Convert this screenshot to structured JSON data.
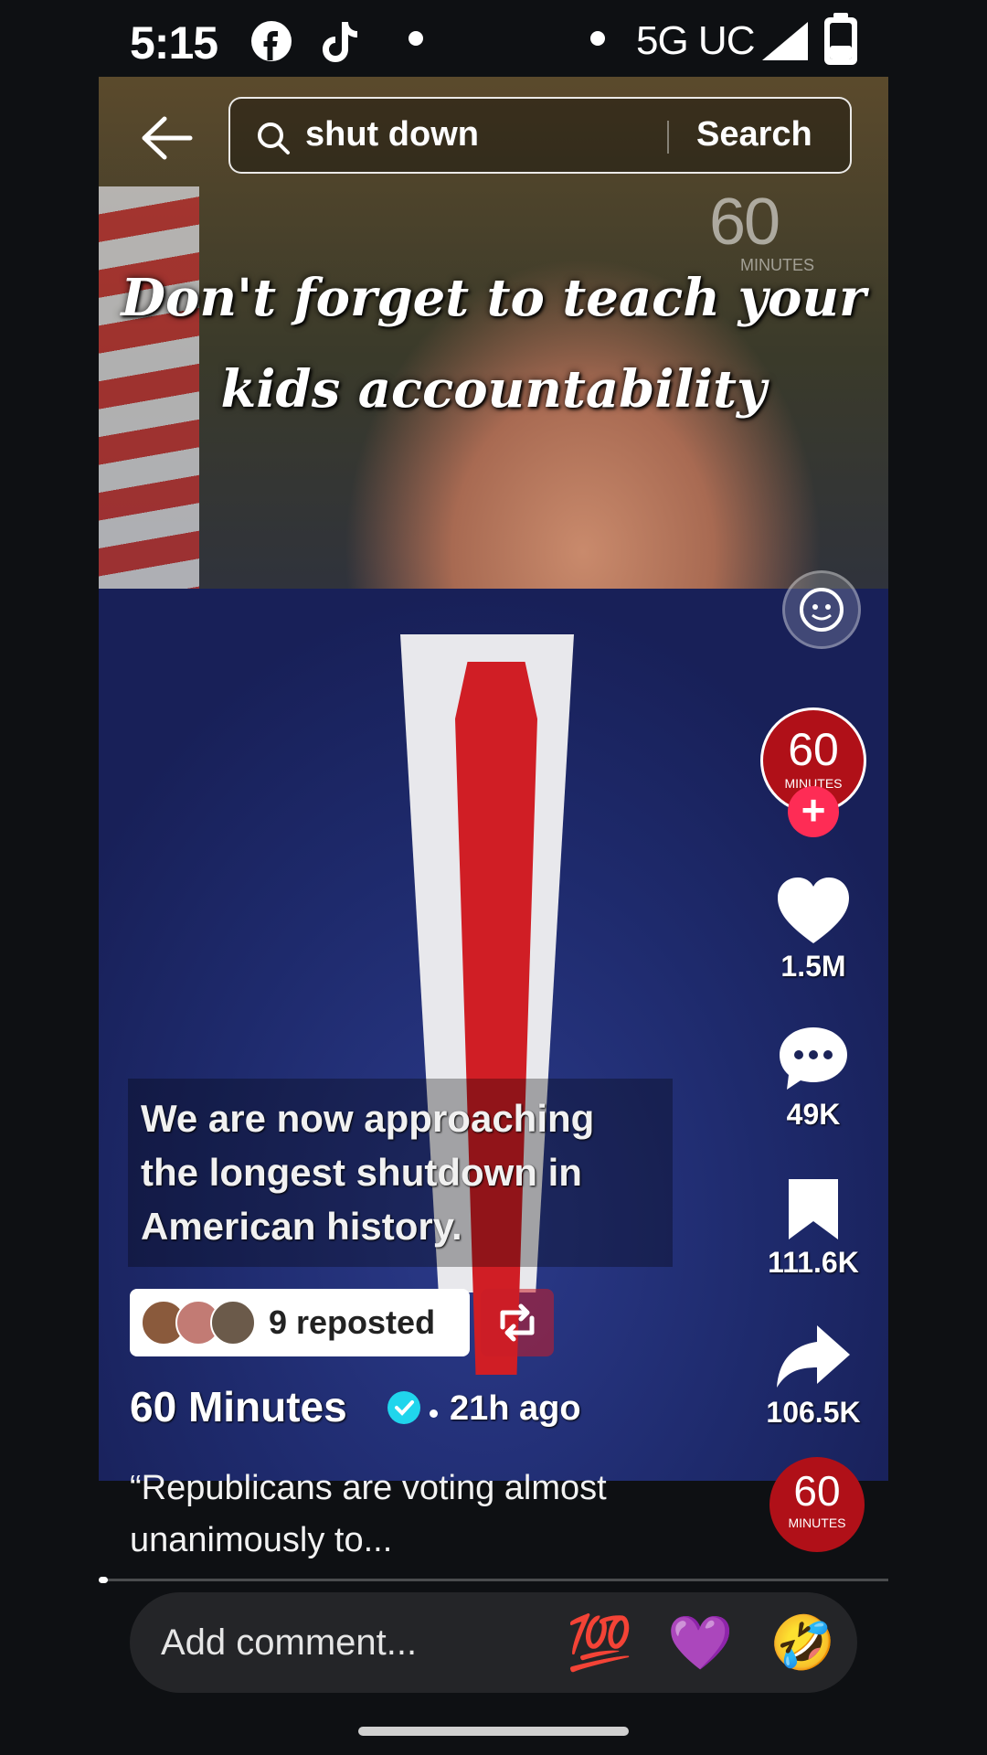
{
  "status_bar": {
    "time": "5:15",
    "network": "5G UC",
    "icons": [
      "facebook-icon",
      "tiktok-icon",
      "signal-icon",
      "battery-icon"
    ]
  },
  "search": {
    "back_icon": "back-arrow-icon",
    "query": "shut down",
    "button_label": "Search",
    "icon": "search-icon"
  },
  "video": {
    "watermark": "60",
    "watermark_sub": "MINUTES",
    "overlay_title": "Don't forget to teach your kids accountability",
    "caption": "We are now approaching the longest shutdown in American history."
  },
  "actions": {
    "avatar_text": "60",
    "avatar_sub": "MINUTES",
    "like_count": "1.5M",
    "comment_count": "49K",
    "save_count": "111.6K",
    "share_count": "106.5K"
  },
  "repost": {
    "label": "9 reposted"
  },
  "post": {
    "author": "60 Minutes",
    "time_ago": "21h ago",
    "description": "“Republicans are voting almost unanimously to..."
  },
  "playback": {
    "progress": 0.012
  },
  "comment": {
    "placeholder": "Add comment...",
    "emojis": [
      "💯",
      "💜",
      "🤣"
    ]
  },
  "colors": {
    "accent": "#fe2c55",
    "verified": "#20d5ec",
    "brand_red": "#b01018"
  }
}
